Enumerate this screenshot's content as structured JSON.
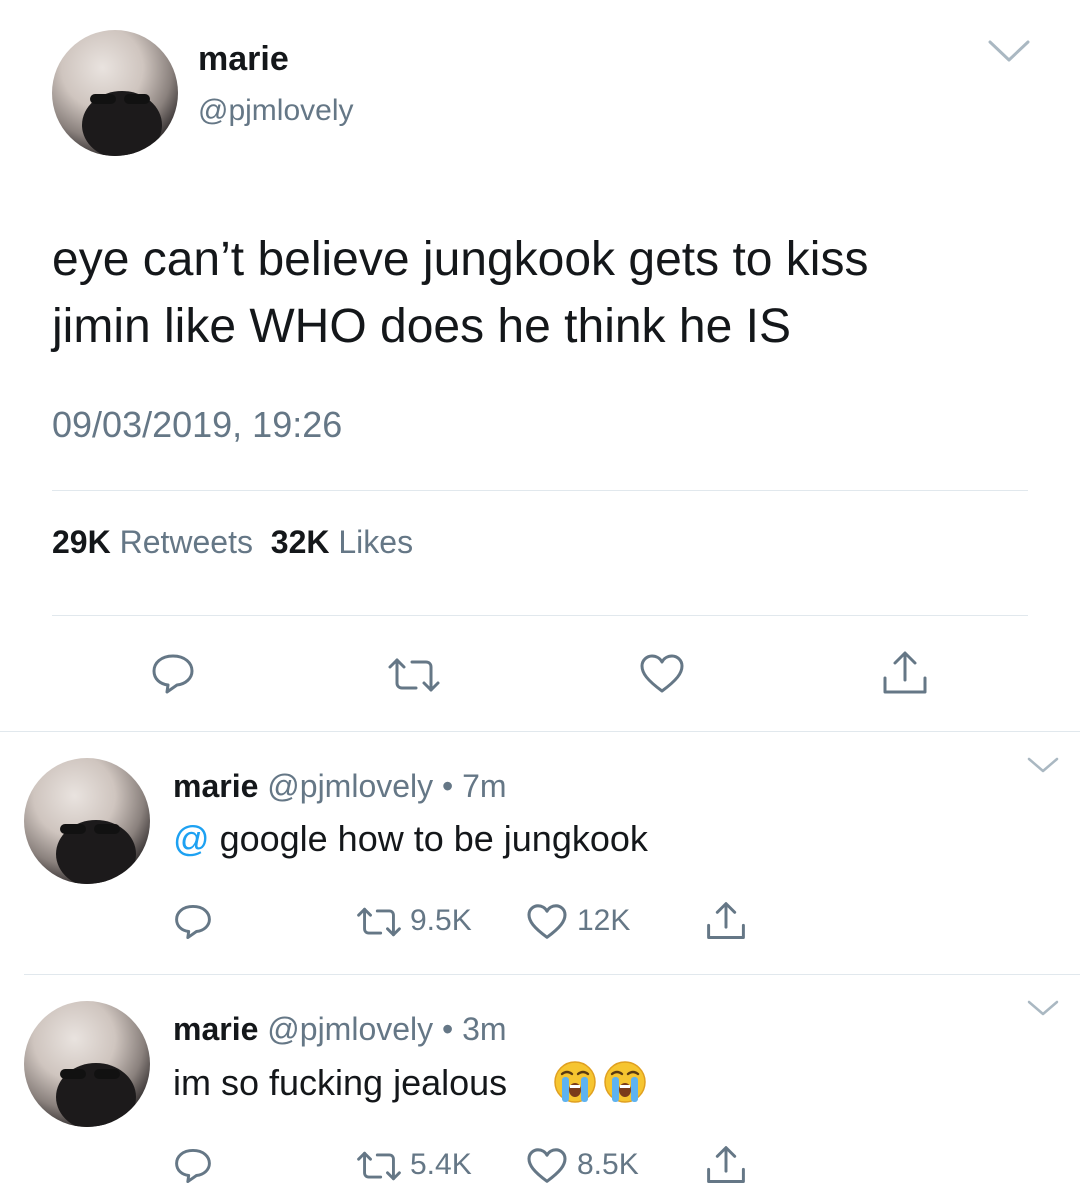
{
  "main_tweet": {
    "display_name": "marie",
    "handle": "@pjmlovely",
    "text_line1": "eye can’t believe jungkook gets to kiss",
    "text_line2": "jimin like WHO does he think he IS",
    "timestamp": "09/03/2019, 19:26",
    "retweets_count": "29K",
    "retweets_label": "Retweets",
    "likes_count": "32K",
    "likes_label": "Likes"
  },
  "replies": [
    {
      "display_name": "marie",
      "handle": "@pjmlovely",
      "separator": "•",
      "time": "7m",
      "mention": "@",
      "text": "google how to be jungkook",
      "retweets": "9.5K",
      "likes": "12K"
    },
    {
      "display_name": "marie",
      "handle": "@pjmlovely",
      "separator": "•",
      "time": "3m",
      "text": "im so fucking jealous",
      "emoji": "loudly-crying-face",
      "retweets": "5.4K",
      "likes": "8.5K"
    }
  ],
  "colors": {
    "text": "#14171a",
    "secondary": "#657786",
    "link": "#1da1f2",
    "divider": "#e1e8ed"
  }
}
